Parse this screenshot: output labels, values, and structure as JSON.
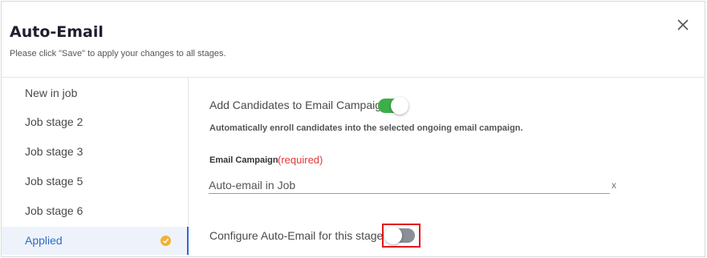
{
  "modal": {
    "title": "Auto-Email",
    "subtitle": "Please click \"Save\" to apply your changes to all stages.",
    "close_icon": "close-icon"
  },
  "sidebar": {
    "items": [
      {
        "label": "New in job",
        "active": false
      },
      {
        "label": "Job stage 2",
        "active": false
      },
      {
        "label": "Job stage 3",
        "active": false
      },
      {
        "label": "Job stage 5",
        "active": false
      },
      {
        "label": "Job stage 6",
        "active": false
      },
      {
        "label": "Applied",
        "active": true,
        "badge_icon": "check-circle-icon"
      }
    ]
  },
  "content": {
    "add_candidates": {
      "label": "Add Candidates to Email Campaign",
      "enabled": true
    },
    "helper_text": "Automatically enroll candidates into the selected ongoing email campaign.",
    "email_campaign": {
      "label": "Email Campaign",
      "required_text": "(required)",
      "value": "Auto-email in Job",
      "clear_text": "x"
    },
    "configure": {
      "label": "Configure Auto-Email for this stage",
      "enabled": false
    }
  },
  "colors": {
    "toggle_on": "#3dae4a",
    "toggle_off": "#8a8f98",
    "active_accent": "#2f6bc8",
    "required": "#e03a3a",
    "highlight_border": "#e01919",
    "check_badge": "#f2b233"
  }
}
